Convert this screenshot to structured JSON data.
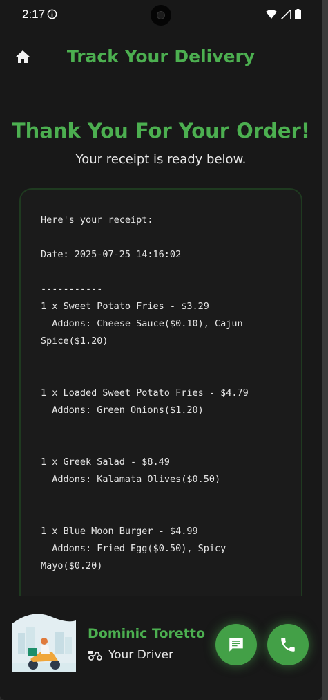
{
  "status_bar": {
    "time": "2:17"
  },
  "header": {
    "title": "Track Your Delivery"
  },
  "main": {
    "heading": "Thank You For Your Order!",
    "subheading": "Your receipt is ready below.",
    "receipt_text": "Here's your receipt:\n\nDate: 2025-07-25 14:16:02\n\n-----------\n1 x Sweet Potato Fries - $3.29\n  Addons: Cheese Sauce($0.10), Cajun\nSpice($1.20)\n\n\n1 x Loaded Sweet Potato Fries - $4.79\n  Addons: Green Onions($1.20)\n\n\n1 x Greek Salad - $8.49\n  Addons: Kalamata Olives($0.50)\n\n\n1 x Blue Moon Burger - $4.99\n  Addons: Fried Egg($0.50), Spicy\nMayo($0.20)"
  },
  "driver": {
    "name": "Dominic Toretto",
    "role": "Your Driver"
  },
  "colors": {
    "accent": "#4caf50",
    "background": "#181818",
    "fab": "#43a047"
  },
  "icons": {
    "home": "home-icon",
    "message": "message-icon",
    "call": "phone-icon",
    "scooter": "scooter-icon"
  }
}
